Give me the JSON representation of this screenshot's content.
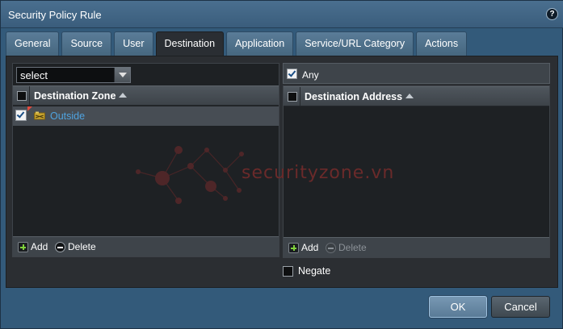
{
  "dialog": {
    "title": "Security Policy Rule",
    "help_icon": "?"
  },
  "tabs": [
    {
      "label": "General",
      "active": false
    },
    {
      "label": "Source",
      "active": false
    },
    {
      "label": "User",
      "active": false
    },
    {
      "label": "Destination",
      "active": true
    },
    {
      "label": "Application",
      "active": false
    },
    {
      "label": "Service/URL Category",
      "active": false
    },
    {
      "label": "Actions",
      "active": false
    }
  ],
  "destination_zone": {
    "select_value": "select",
    "column_header": "Destination Zone",
    "rows": [
      {
        "label": "Outside",
        "checked": true,
        "icon": "zone-icon"
      }
    ],
    "add_label": "Add",
    "delete_label": "Delete"
  },
  "destination_address": {
    "any_label": "Any",
    "any_checked": true,
    "column_header": "Destination Address",
    "add_label": "Add",
    "delete_label": "Delete",
    "delete_disabled": true,
    "negate_label": "Negate",
    "negate_checked": false
  },
  "watermark": {
    "text": "securityzone.vn"
  },
  "buttons": {
    "ok_label": "OK",
    "cancel_label": "Cancel"
  },
  "colors": {
    "accent": "#4fa3df",
    "add_green": "#7fd13b",
    "panel_dark": "#1e2124",
    "dialog_blue": "#335a7a"
  }
}
